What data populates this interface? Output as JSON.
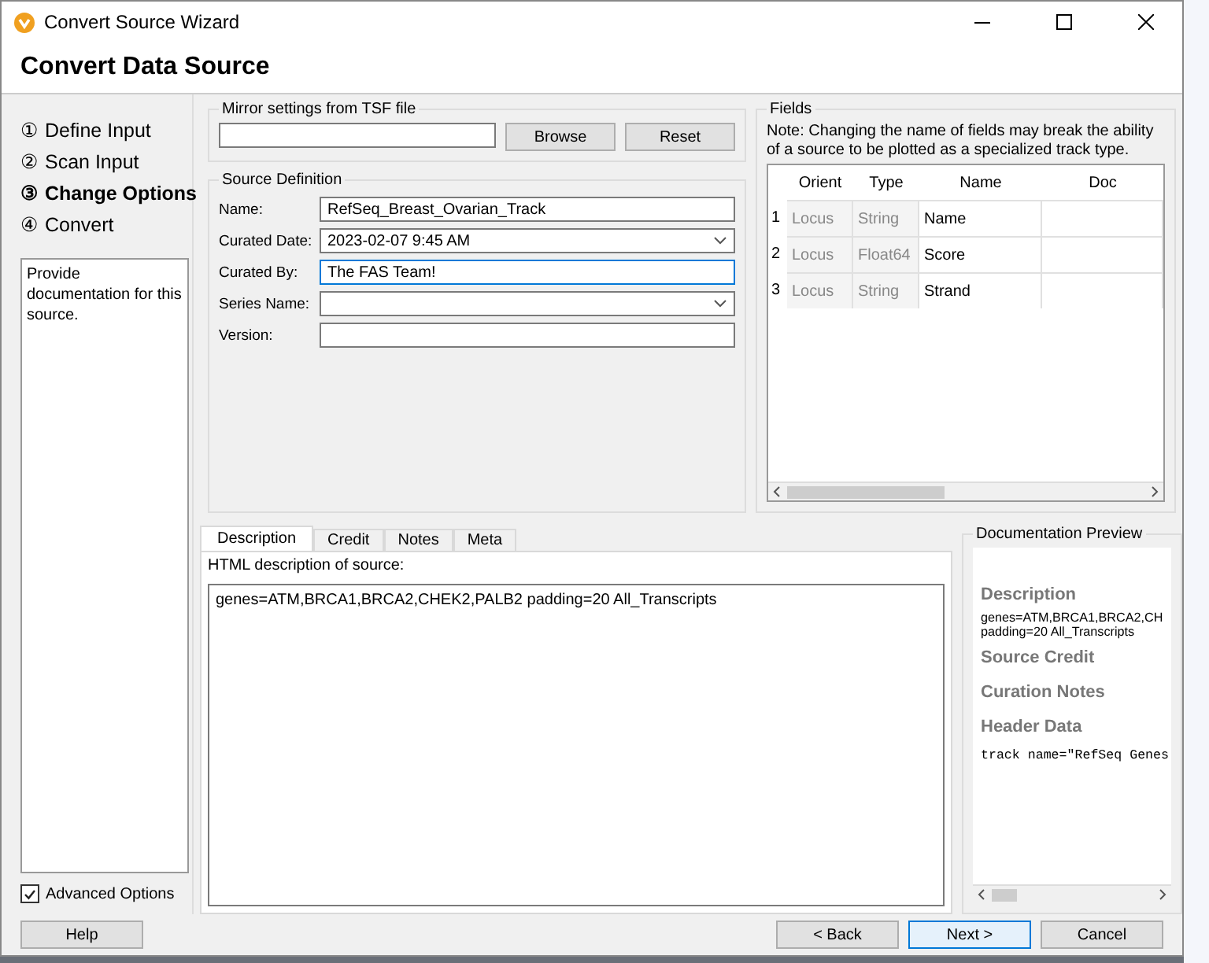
{
  "window": {
    "title": "Convert Source Wizard"
  },
  "header": {
    "title": "Convert Data Source"
  },
  "steps": [
    {
      "number": "①",
      "label": "Define Input",
      "selected": false
    },
    {
      "number": "②",
      "label": "Scan Input",
      "selected": false
    },
    {
      "number": "③",
      "label": "Change Options",
      "selected": true
    },
    {
      "number": "④",
      "label": "Convert",
      "selected": false
    }
  ],
  "step_hint": "Provide documentation for this source.",
  "advanced_options": {
    "label": "Advanced Options",
    "checked": true
  },
  "mirror": {
    "title": "Mirror settings from TSF file",
    "buttons": [
      "Browse",
      "Reset"
    ]
  },
  "source_definition": {
    "title": "Source Definition",
    "fields": [
      {
        "label": "Name:",
        "value": "RefSeq_Breast_Ovarian_Track",
        "kind": "text",
        "focused": false
      },
      {
        "label": "Curated Date:",
        "value": "2023-02-07 9:45 AM",
        "kind": "dropdown",
        "focused": false
      },
      {
        "label": "Curated By:",
        "value": "The FAS Team!",
        "kind": "text",
        "focused": true
      },
      {
        "label": "Series Name:",
        "kind": "dropdown",
        "focused": false
      },
      {
        "label": "Version:",
        "kind": "text",
        "focused": false
      }
    ]
  },
  "fields": {
    "title": "Fields",
    "note": "Note: Changing the name of fields may break the ability of a source to be plotted as a specialized track type.",
    "columns": [
      "Orient",
      "Type",
      "Name",
      "Doc"
    ],
    "rows": [
      {
        "index": "1",
        "orient": "Locus",
        "type": "String",
        "name": "Name"
      },
      {
        "index": "2",
        "orient": "Locus",
        "type": "Float64",
        "name": "Score"
      },
      {
        "index": "3",
        "orient": "Locus",
        "type": "String",
        "name": "Strand"
      }
    ]
  },
  "tabs": [
    {
      "label": "Description",
      "selected": true
    },
    {
      "label": "Credit",
      "selected": false
    },
    {
      "label": "Notes",
      "selected": false
    },
    {
      "label": "Meta",
      "selected": false
    }
  ],
  "description": {
    "label": "HTML description of source:",
    "value": "genes=ATM,BRCA1,BRCA2,CHEK2,PALB2 padding=20 All_Transcripts"
  },
  "preview": {
    "title": "Documentation Preview",
    "sections": [
      {
        "kind": "heading",
        "text": "Description"
      },
      {
        "kind": "text",
        "text": "genes=ATM,BRCA1,BRCA2,CH"
      },
      {
        "kind": "text",
        "text": "padding=20 All_Transcripts"
      },
      {
        "kind": "heading",
        "text": "Source Credit"
      },
      {
        "kind": "heading",
        "text": "Curation Notes"
      },
      {
        "kind": "heading",
        "text": "Header Data"
      },
      {
        "kind": "code",
        "text": "track name=\"RefSeq Genes"
      }
    ]
  },
  "help_button": "Help",
  "buttons": [
    {
      "label": "< Back",
      "default": false
    },
    {
      "label": "Next >",
      "default": true
    },
    {
      "label": "Cancel",
      "default": false
    }
  ]
}
